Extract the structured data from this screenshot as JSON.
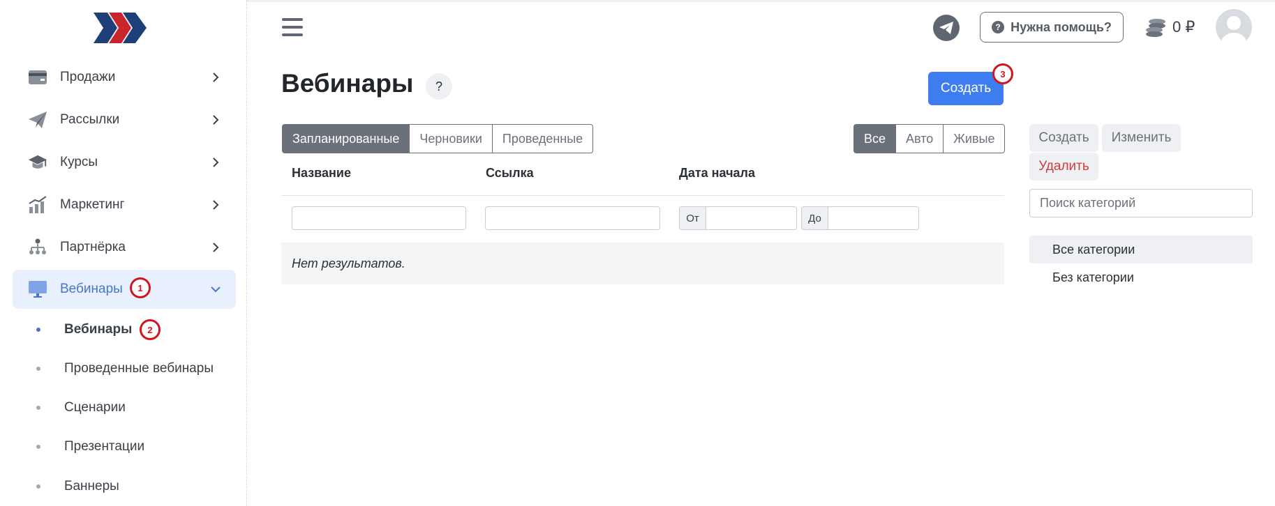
{
  "sidebar": {
    "items": [
      {
        "label": "Продажи",
        "icon": "credit-card-icon"
      },
      {
        "label": "Рассылки",
        "icon": "paper-plane-icon"
      },
      {
        "label": "Курсы",
        "icon": "graduation-cap-icon"
      },
      {
        "label": "Маркетинг",
        "icon": "chart-growth-icon"
      },
      {
        "label": "Партнёрка",
        "icon": "network-people-icon"
      },
      {
        "label": "Вебинары",
        "icon": "monitor-icon",
        "expanded": true
      }
    ],
    "subitems": [
      {
        "label": "Вебинары",
        "current": true
      },
      {
        "label": "Проведенные вебинары"
      },
      {
        "label": "Сценарии"
      },
      {
        "label": "Презентации"
      },
      {
        "label": "Баннеры"
      }
    ]
  },
  "header": {
    "help_label": "Нужна помощь?",
    "help_icon": "?",
    "balance": "0 ₽"
  },
  "page": {
    "title": "Вебинары",
    "help_button": "?",
    "create_label": "Создать"
  },
  "status_tabs": [
    "Запланированные",
    "Черновики",
    "Проведенные"
  ],
  "type_tabs": [
    "Все",
    "Авто",
    "Живые"
  ],
  "table": {
    "columns": [
      "Название",
      "Ссылка",
      "Дата начала"
    ],
    "date_from": "От",
    "date_to": "До",
    "empty_text": "Нет результатов."
  },
  "categories": {
    "create": "Создать",
    "edit": "Изменить",
    "delete": "Удалить",
    "search_placeholder": "Поиск категорий",
    "items": [
      "Все категории",
      "Без категории"
    ]
  },
  "annotations": [
    "1",
    "2",
    "3"
  ],
  "colors": {
    "primary": "#3d7df0",
    "active_nav_bg": "#e9f0fd",
    "active_nav_text": "#4a74c8",
    "annotation": "#d2151d",
    "danger": "#d23a3a",
    "segment_active": "#6b717b"
  }
}
